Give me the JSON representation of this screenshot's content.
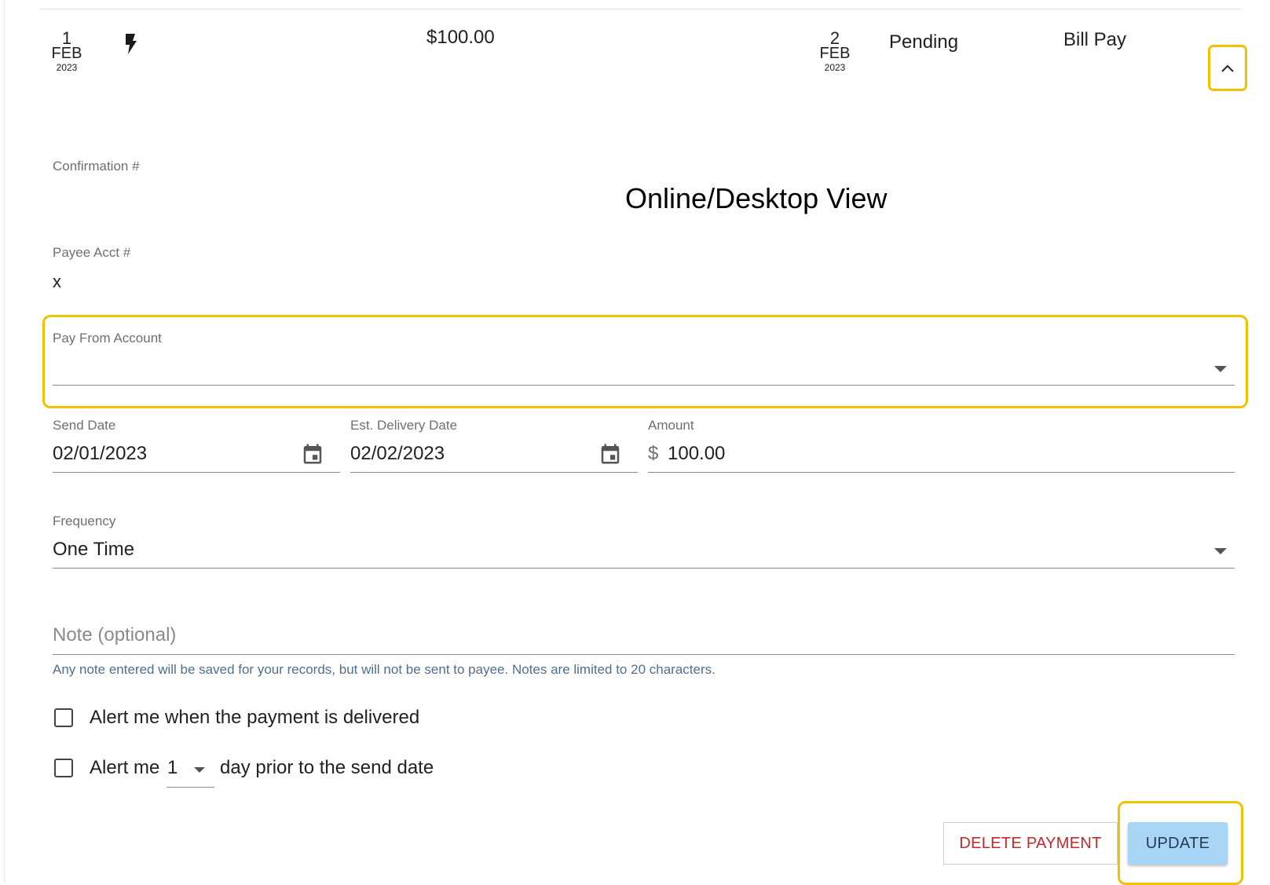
{
  "payment": {
    "send_date": {
      "day": "1",
      "month": "FEB",
      "year": "2023"
    },
    "amount": "$100.00",
    "delivery_date": {
      "day": "2",
      "month": "FEB",
      "year": "2023"
    },
    "status": "Pending",
    "type": "Bill Pay"
  },
  "overlay_caption": "Online/Desktop View",
  "details": {
    "confirmation_label": "Confirmation #",
    "payee_acct_label": "Payee Acct #",
    "payee_acct_value": "x"
  },
  "form": {
    "pay_from_label": "Pay From Account",
    "send_date_label": "Send Date",
    "send_date_value": "02/01/2023",
    "delivery_date_label": "Est. Delivery Date",
    "delivery_date_value": "02/02/2023",
    "amount_label": "Amount",
    "currency_symbol": "$",
    "amount_value": "100.00",
    "frequency_label": "Frequency",
    "frequency_value": "One Time",
    "note_placeholder": "Note (optional)",
    "note_hint": "Any note entered will be saved for your records, but will not be sent to payee. Notes are limited to 20 characters.",
    "alert_delivered_label": "Alert me when the payment is delivered",
    "alert_prior_prefix": "Alert me",
    "alert_prior_days": "1",
    "alert_prior_suffix": "day prior to the send date"
  },
  "actions": {
    "delete_label": "DELETE PAYMENT",
    "update_label": "UPDATE"
  },
  "colors": {
    "highlight": "#f2c200",
    "update_button": "#a8d4f5",
    "delete_text": "#c62828"
  },
  "icons": [
    "bolt-icon",
    "chevron-up-icon",
    "calendar-icon",
    "dropdown-arrow-icon",
    "checkbox-icon"
  ]
}
